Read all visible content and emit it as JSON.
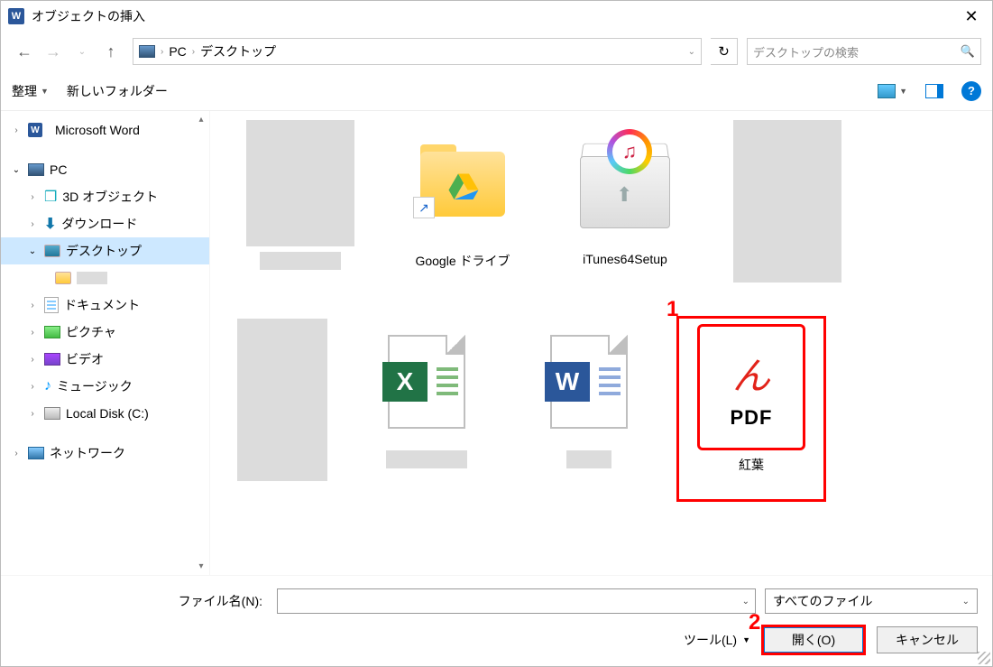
{
  "title": "オブジェクトの挿入",
  "breadcrumb": {
    "root": "PC",
    "folder": "デスクトップ"
  },
  "search": {
    "placeholder": "デスクトップの検索"
  },
  "toolbar": {
    "organize": "整理",
    "newfolder": "新しいフォルダー"
  },
  "tree": {
    "word": "Microsoft Word",
    "pc": "PC",
    "objects3d": "3D オブジェクト",
    "downloads": "ダウンロード",
    "desktop": "デスクトップ",
    "documents": "ドキュメント",
    "pictures": "ピクチャ",
    "videos": "ビデオ",
    "music": "ミュージック",
    "localdisk": "Local Disk (C:)",
    "network": "ネットワーク"
  },
  "files": {
    "gdrive": "Google ドライブ",
    "itunes": "iTunes64Setup",
    "pdf": "紅葉",
    "pdf_badge": "PDF"
  },
  "bottom": {
    "filename_label": "ファイル名(N):",
    "filetype": "すべてのファイル",
    "tools": "ツール(L)",
    "open": "開く(O)",
    "cancel": "キャンセル"
  },
  "annotations": {
    "one": "1",
    "two": "2"
  }
}
